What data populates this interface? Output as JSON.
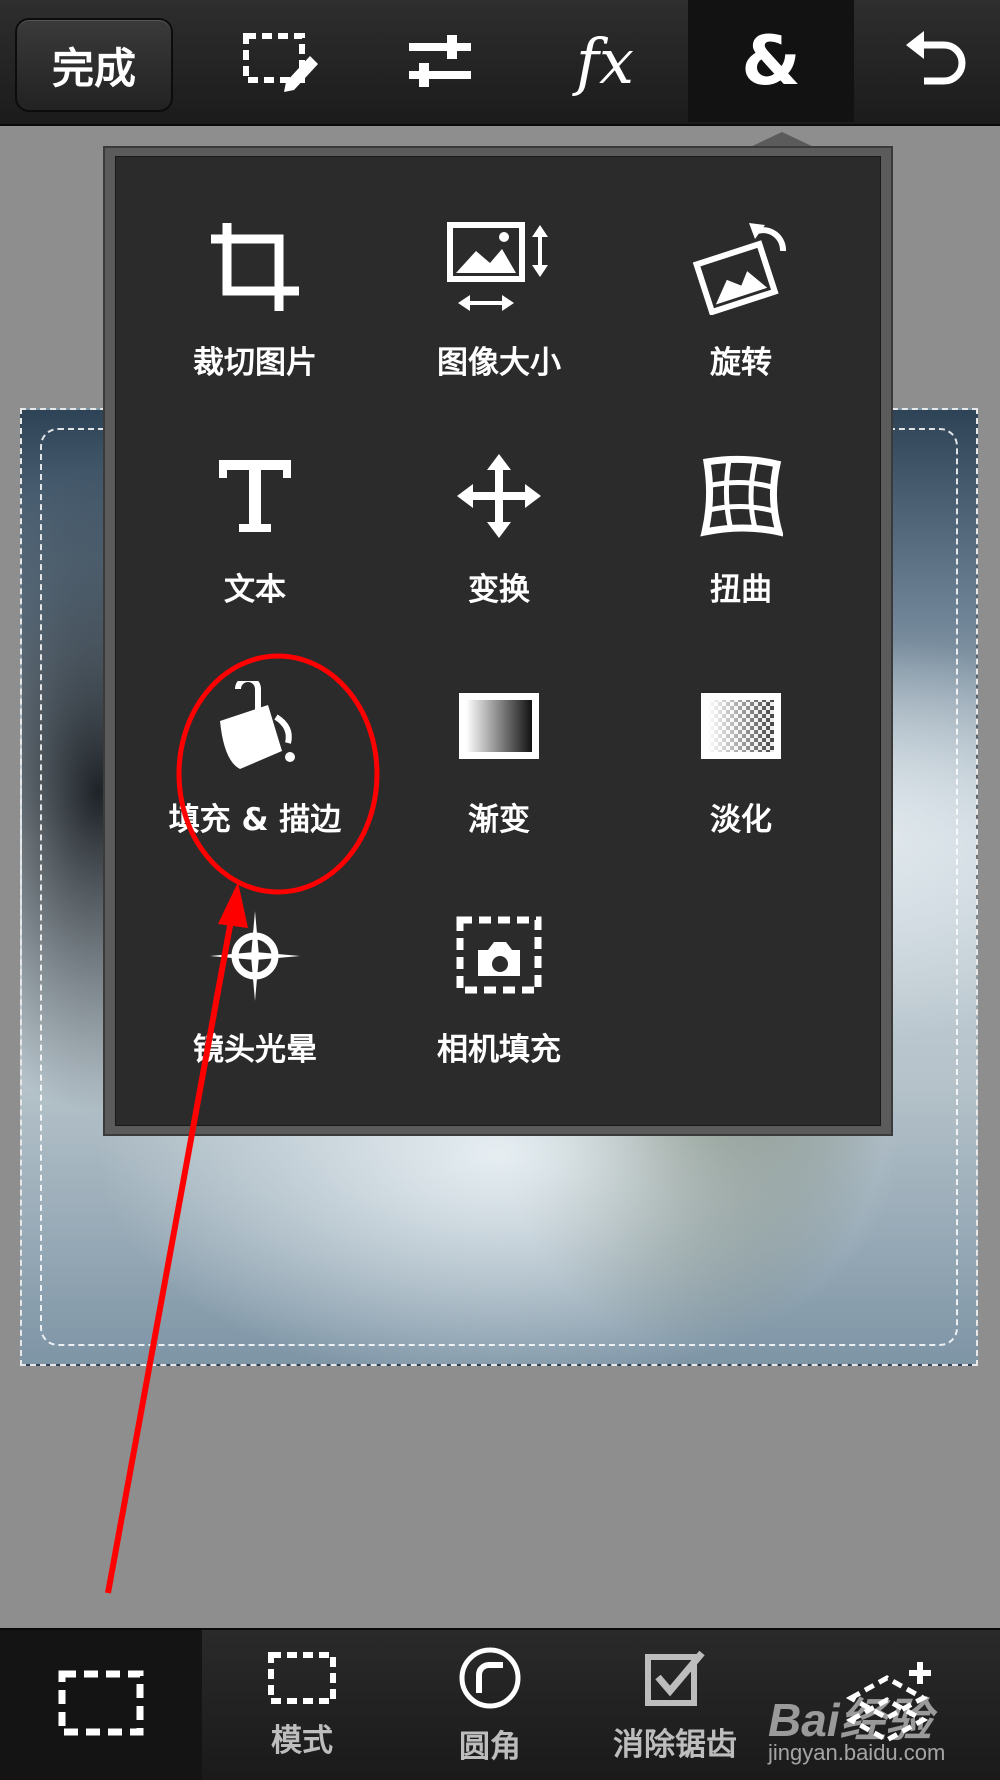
{
  "toolbar": {
    "done_label": "完成",
    "icons": [
      "selection-edit-icon",
      "adjustments-icon",
      "fx-icon",
      "ampersand-icon",
      "undo-icon"
    ],
    "fx_label": "fx",
    "amp_label": "&",
    "active": "ampersand"
  },
  "menu": {
    "items": [
      {
        "label": "裁切图片",
        "icon": "crop-icon"
      },
      {
        "label": "图像大小",
        "icon": "image-size-icon"
      },
      {
        "label": "旋转",
        "icon": "rotate-icon"
      },
      {
        "label": "文本",
        "icon": "text-icon"
      },
      {
        "label": "变换",
        "icon": "transform-icon"
      },
      {
        "label": "扭曲",
        "icon": "distort-icon"
      },
      {
        "label": "填充 & 描边",
        "icon": "fill-stroke-icon",
        "highlighted": true
      },
      {
        "label": "渐变",
        "icon": "gradient-icon"
      },
      {
        "label": "淡化",
        "icon": "fade-icon"
      },
      {
        "label": "镜头光晕",
        "icon": "lens-flare-icon"
      },
      {
        "label": "相机填充",
        "icon": "camera-fill-icon"
      }
    ]
  },
  "bottom": {
    "items": [
      {
        "label": "",
        "icon": "selection-icon"
      },
      {
        "label": "模式",
        "icon": "mode-icon"
      },
      {
        "label": "圆角",
        "icon": "rounded-corner-icon"
      },
      {
        "label": "消除锯齿",
        "icon": "antialias-icon"
      },
      {
        "label": "",
        "icon": "add-selection-icon"
      }
    ]
  },
  "watermark": {
    "brand": "Bai经验",
    "url": "jingyan.baidu.com"
  },
  "annotation_color": "#ff0000"
}
